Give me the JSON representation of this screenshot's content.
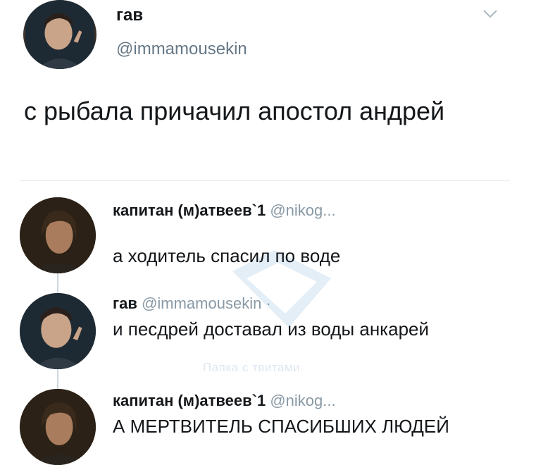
{
  "main_tweet": {
    "author_name": "гав",
    "author_handle": "@immamousekin",
    "text": "с рыбала причачил апостол андрей"
  },
  "replies": [
    {
      "name": "капитан (м)атвеев`1",
      "handle": "@nikog...",
      "text": "а ходитель спасил по воде"
    },
    {
      "name": "гав",
      "handle": "@immamousekin ·",
      "text": "и песдрей доставал из воды анкарей"
    },
    {
      "name": "капитан (м)атвеев`1",
      "handle": "@nikog...",
      "text": "А МЕРТВИТЕЛЬ СПАСИБШИХ ЛЮДЕЙ"
    }
  ],
  "watermark": {
    "text": "Папка с твитами"
  },
  "icons": {
    "menu": "chevron-down-icon"
  },
  "colors": {
    "handle": "#657786",
    "divider": "#e6ecf0",
    "thread_line": "#ccd6dd"
  }
}
